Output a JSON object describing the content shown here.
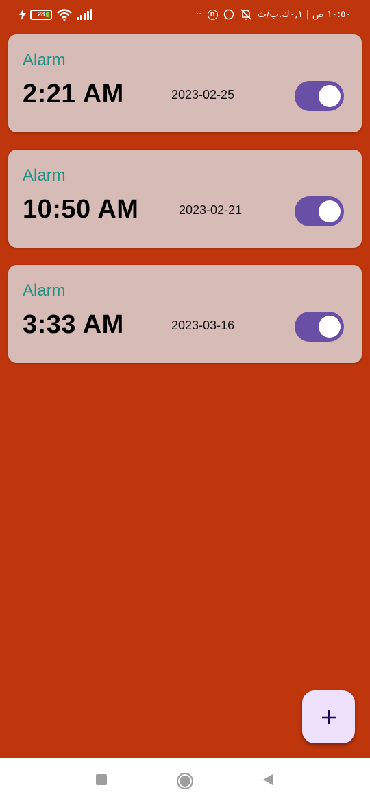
{
  "status_bar": {
    "battery_level": "28",
    "right_text": "١٠:٥٠ ص | ٠,١ك.ب/ث",
    "dots": "··",
    "b_badge": "B",
    "icons": [
      "charging-bolt-icon",
      "battery-icon",
      "wifi-icon",
      "signal-icon",
      "dnd-bell-off-icon",
      "whatsapp-icon"
    ]
  },
  "alarms": [
    {
      "label": "Alarm",
      "time": "2:21 AM",
      "date": "2023-02-25",
      "enabled": true
    },
    {
      "label": "Alarm",
      "time": "10:50 AM",
      "date": "2023-02-21",
      "enabled": true
    },
    {
      "label": "Alarm",
      "time": "3:33 AM",
      "date": "2023-03-16",
      "enabled": true
    }
  ],
  "fab": {
    "icon": "plus-icon",
    "label": "+"
  },
  "nav_bar": {
    "icons": [
      "recents-square-icon",
      "home-circle-icon",
      "back-triangle-icon"
    ]
  },
  "colors": {
    "background": "#bf350c",
    "card": "#d6bbb7",
    "label": "#1f9184",
    "toggle_on": "#6a4fa7",
    "fab": "#ece0fa"
  }
}
